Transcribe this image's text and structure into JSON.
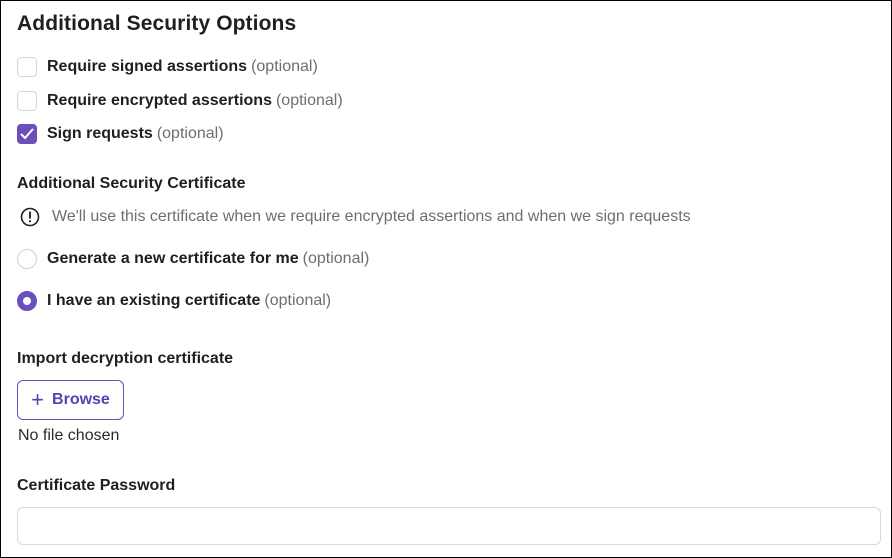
{
  "title": "Additional Security Options",
  "options": [
    {
      "label": "Require signed assertions",
      "optional": "(optional)",
      "checked": false
    },
    {
      "label": "Require encrypted assertions",
      "optional": "(optional)",
      "checked": false
    },
    {
      "label": "Sign requests",
      "optional": "(optional)",
      "checked": true
    }
  ],
  "certificate": {
    "heading": "Additional Security Certificate",
    "info_icon": "info-circle-icon",
    "info_text": "We'll use this certificate when we require encrypted assertions and when we sign requests",
    "choices": [
      {
        "label": "Generate a new certificate for me",
        "optional": "(optional)",
        "selected": false
      },
      {
        "label": "I have an existing certificate",
        "optional": "(optional)",
        "selected": true
      }
    ]
  },
  "import": {
    "heading": "Import decryption certificate",
    "browse_label": "Browse",
    "browse_icon": "plus-icon",
    "file_status": "No file chosen"
  },
  "password": {
    "heading": "Certificate Password",
    "value": "",
    "placeholder": ""
  },
  "colors": {
    "accent": "#6b4fbb",
    "muted_text": "#6e6e6e"
  }
}
